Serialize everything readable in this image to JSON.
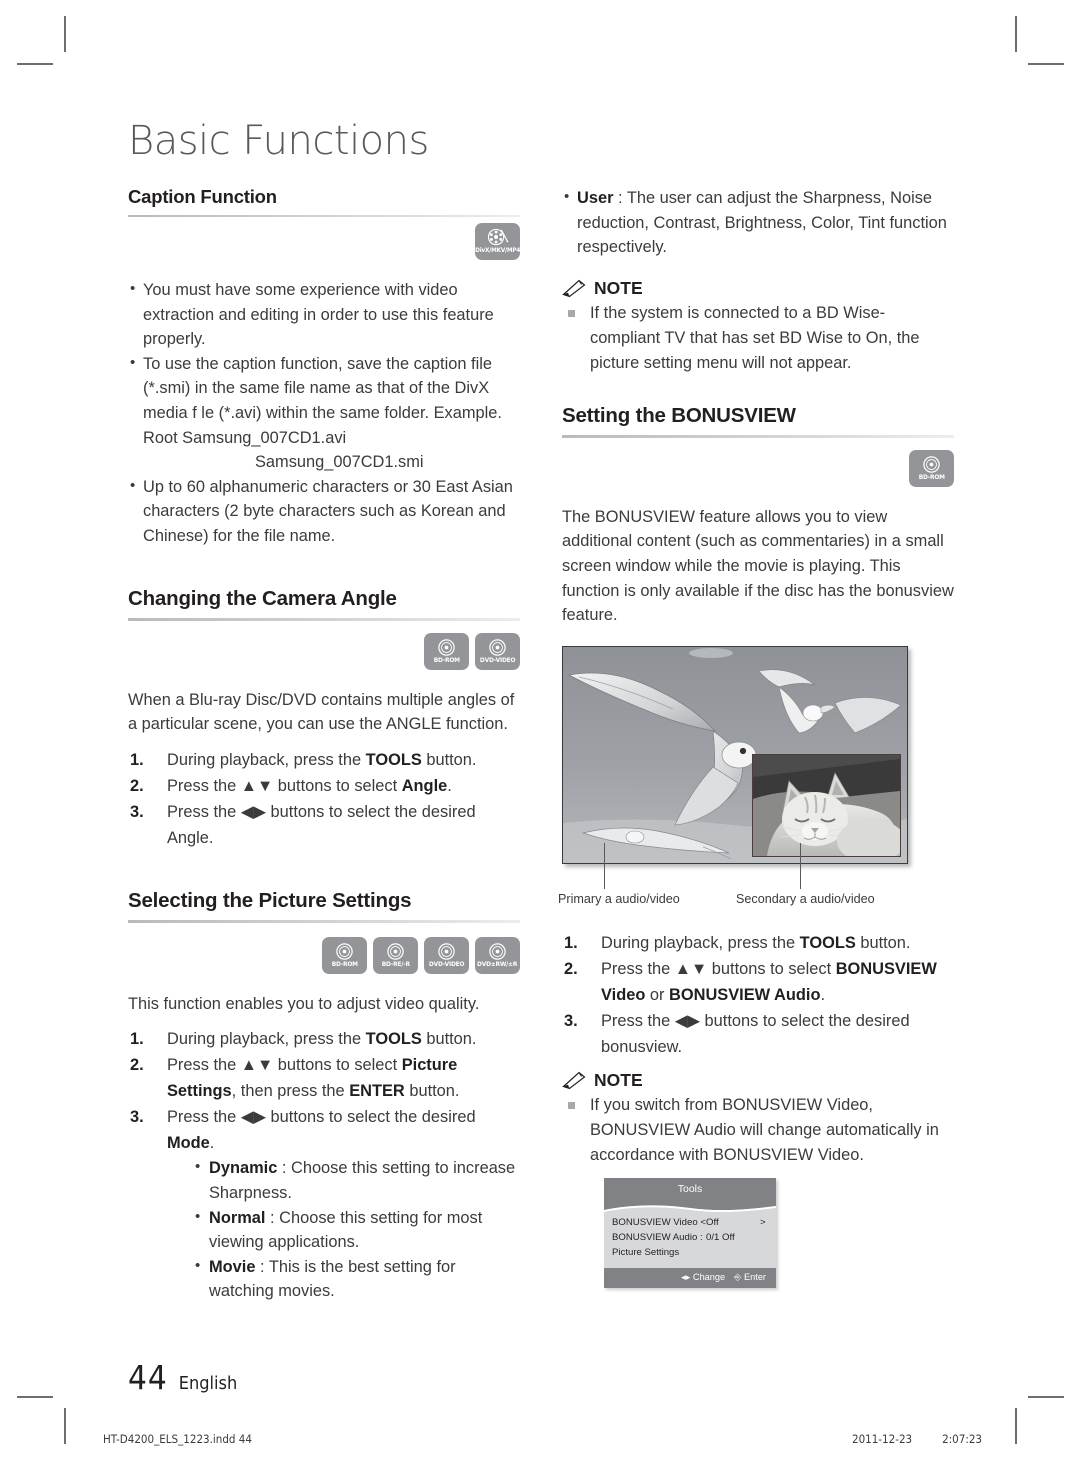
{
  "chapter": {
    "title": "Basic Functions"
  },
  "left": {
    "caption_function": {
      "heading": "Caption Function",
      "media_icons": [
        {
          "label": "DivX/MKV/MP4",
          "glyph": "divx-film-icon"
        }
      ],
      "bullets": [
        "You must have some experience with video extraction and editing in order to use this feature properly.",
        "To use the caption function, save the caption file (*.smi) in the same file name as that of the DivX media f le (*.avi) within the same folder. Example. Root Samsung_007CD1.avi",
        "Up to 60 alphanumeric characters or 30 East Asian characters (2 byte characters such as Korean and Chinese) for the file name."
      ],
      "bullet2_indent_line": "Samsung_007CD1.smi"
    },
    "camera_angle": {
      "heading": "Changing the Camera Angle",
      "media_icons": [
        {
          "label": "BD-ROM",
          "glyph": "disc-icon"
        },
        {
          "label": "DVD-VIDEO",
          "glyph": "disc-icon"
        }
      ],
      "intro": "When a Blu-ray Disc/DVD contains multiple angles of a particular scene, you can use the ANGLE function.",
      "steps": [
        {
          "num": "1.",
          "pre": "During playback, press the ",
          "bold": "TOOLS",
          "post": " button."
        },
        {
          "num": "2.",
          "pre": "Press the ▲▼ buttons to select ",
          "bold": "Angle",
          "post": "."
        },
        {
          "num": "3.",
          "pre": "Press the ◀▶ buttons to select the desired Angle.",
          "bold": "",
          "post": ""
        }
      ]
    },
    "picture_settings": {
      "heading": "Selecting the Picture Settings",
      "media_icons": [
        {
          "label": "BD-ROM",
          "glyph": "disc-icon"
        },
        {
          "label": "BD-RE/-R",
          "glyph": "disc-icon"
        },
        {
          "label": "DVD-VIDEO",
          "glyph": "disc-icon"
        },
        {
          "label": "DVD±RW/±R",
          "glyph": "disc-icon"
        }
      ],
      "intro": "This function enables you to adjust video quality.",
      "step1_pre": "During playback, press the ",
      "step1_bold": "TOOLS",
      "step1_post": " button.",
      "step2_pre": "Press the ▲▼ buttons to select ",
      "step2_bold": "Picture Settings",
      "step2_mid": ", then press the ",
      "step2_bold2": "ENTER",
      "step2_post": " button.",
      "step3_pre": "Press the ◀▶ buttons to select the desired ",
      "step3_bold": "Mode",
      "step3_post": ".",
      "modes": [
        {
          "name": "Dynamic",
          "desc": " : Choose this setting to increase Sharpness."
        },
        {
          "name": "Normal",
          "desc": " : Choose this setting for most viewing applications."
        },
        {
          "name": "Movie",
          "desc": " : This is the best setting for watching movies."
        }
      ]
    }
  },
  "right": {
    "user_mode": {
      "name": "User",
      "desc": " : The user can adjust the Sharpness, Noise reduction, Contrast, Brightness, Color, Tint function respectively."
    },
    "note1": {
      "label": "NOTE",
      "items": [
        "If the system is connected to a BD Wise-compliant TV that has set BD Wise to On, the picture setting menu will not appear."
      ]
    },
    "bonusview": {
      "heading": "Setting the BONUSVIEW",
      "media_icons": [
        {
          "label": "BD-ROM",
          "glyph": "disc-icon"
        }
      ],
      "intro": "The BONUSVIEW feature allows you to view additional content (such as commentaries) in a small screen window while the movie is playing. This function is only available if the disc has the bonusview feature.",
      "figure": {
        "primary_caption": "Primary a audio/video",
        "secondary_caption": "Secondary a audio/video"
      },
      "steps": [
        {
          "num": "1.",
          "pre": "During playback, press the ",
          "bold": "TOOLS",
          "post": " button."
        },
        {
          "num": "2.",
          "pre": "Press the ▲▼ buttons to select ",
          "bold": "BONUSVIEW Video",
          "mid": " or ",
          "bold2": "BONUSVIEW Audio",
          "post": "."
        },
        {
          "num": "3.",
          "pre": "Press the ◀▶ buttons to select the desired bonusview.",
          "bold": "",
          "post": ""
        }
      ]
    },
    "note2": {
      "label": "NOTE",
      "items": [
        "If you switch from BONUSVIEW Video, BONUSVIEW Audio will change automatically in accordance with BONUSVIEW Video."
      ]
    },
    "osd": {
      "title": "Tools",
      "rows": [
        {
          "label": "BONUSVIEW Video <",
          "value": "Off",
          "arrow_right": ">"
        },
        {
          "label": "BONUSVIEW Audio :",
          "value": "0/1 Off",
          "arrow_right": ""
        },
        {
          "label": "Picture Settings",
          "value": "",
          "arrow_right": ""
        }
      ],
      "footer_change": "◂▸ Change",
      "footer_enter": "⎆ Enter"
    }
  },
  "footer": {
    "page_number": "44",
    "language": "English",
    "file_name": "HT-D4200_ELS_1223.indd   44",
    "date": "2011-12-23",
    "time": "2:07:23"
  }
}
